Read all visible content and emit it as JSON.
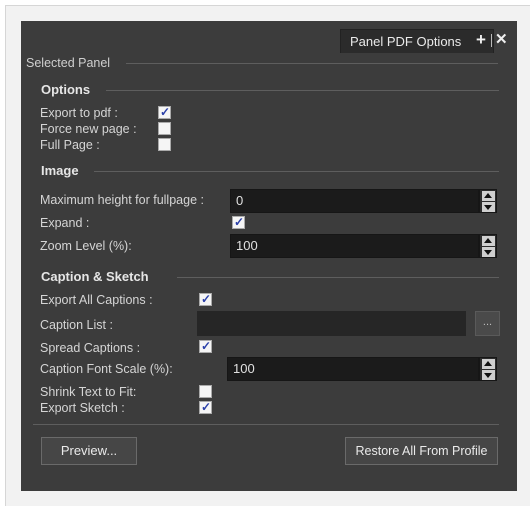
{
  "tab": {
    "title": "Panel PDF Options",
    "add_icon": "plus-icon",
    "close_icon": "close-icon"
  },
  "section_title": "Selected Panel",
  "options": {
    "title": "Options",
    "export_to_pdf": {
      "label": "Export to pdf :",
      "checked": true
    },
    "force_new_page": {
      "label": "Force new page :",
      "checked": false
    },
    "full_page": {
      "label": "Full Page :",
      "checked": false
    }
  },
  "image": {
    "title": "Image",
    "max_height": {
      "label": "Maximum height for fullpage :",
      "value": "0"
    },
    "expand": {
      "label": "Expand :",
      "checked": true
    },
    "zoom_level": {
      "label": "Zoom Level (%):",
      "value": "100"
    }
  },
  "caption": {
    "title": "Caption & Sketch",
    "export_all": {
      "label": "Export All Captions :",
      "checked": true
    },
    "caption_list": {
      "label": "Caption List :",
      "value": "",
      "browse": "..."
    },
    "spread": {
      "label": "Spread Captions :",
      "checked": true
    },
    "font_scale": {
      "label": "Caption Font Scale (%):",
      "value": "100"
    },
    "shrink": {
      "label": "Shrink Text to Fit:",
      "checked": false
    },
    "export_sketch": {
      "label": "Export Sketch :",
      "checked": true
    }
  },
  "buttons": {
    "preview": "Preview...",
    "restore": "Restore All From Profile"
  }
}
